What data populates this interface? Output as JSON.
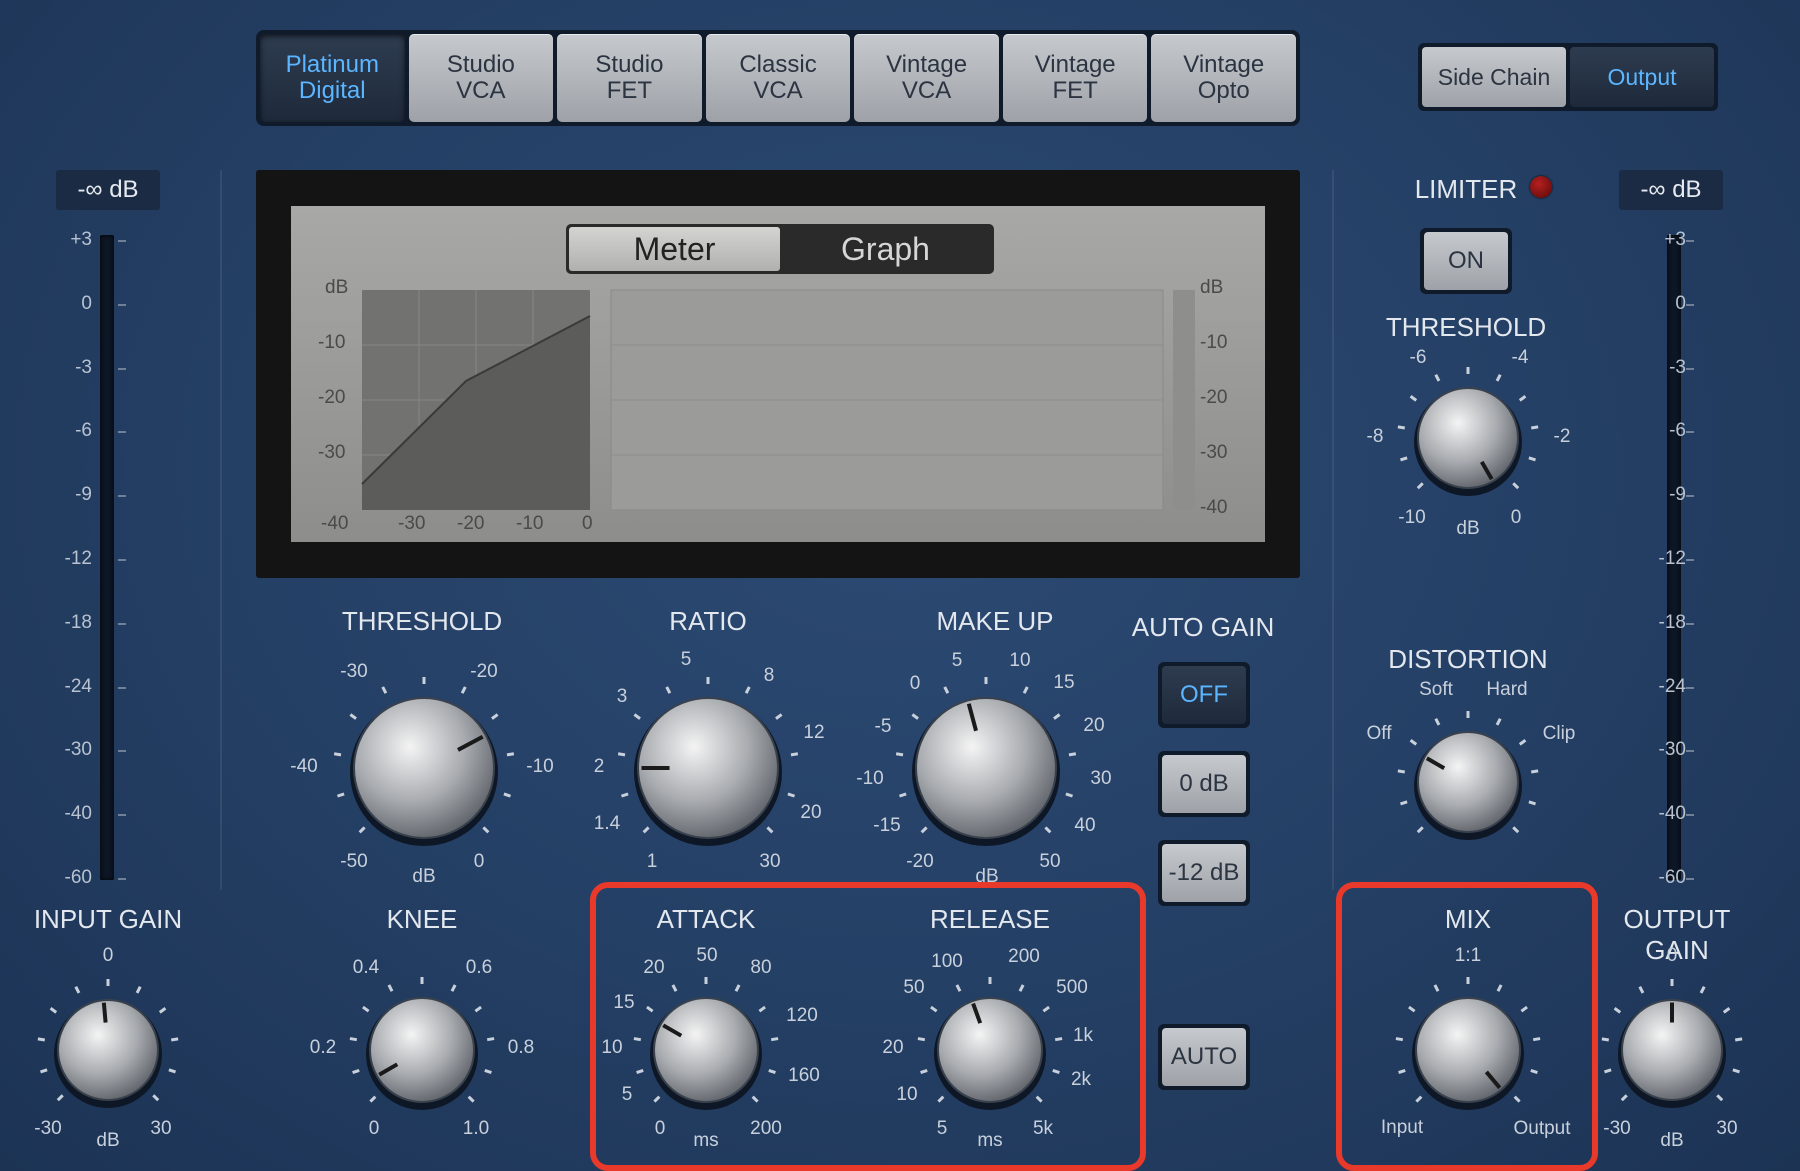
{
  "models": [
    {
      "label": "Platinum\nDigital",
      "active": true
    },
    {
      "label": "Studio\nVCA",
      "active": false
    },
    {
      "label": "Studio\nFET",
      "active": false
    },
    {
      "label": "Classic\nVCA",
      "active": false
    },
    {
      "label": "Vintage\nVCA",
      "active": false
    },
    {
      "label": "Vintage\nFET",
      "active": false
    },
    {
      "label": "Vintage\nOpto",
      "active": false
    }
  ],
  "routing": {
    "side_chain": "Side Chain",
    "output": "Output",
    "selected": "Output"
  },
  "input_meter": {
    "readout": "-∞ dB",
    "scale": [
      "+3",
      "0",
      "-3",
      "-6",
      "-9",
      "-12",
      "-18",
      "-24",
      "-30",
      "-40",
      "-60"
    ]
  },
  "output_meter": {
    "readout": "-∞ dB",
    "scale": [
      "+3",
      "0",
      "-3",
      "-6",
      "-9",
      "-12",
      "-18",
      "-24",
      "-30",
      "-40",
      "-60"
    ]
  },
  "display": {
    "tabs": {
      "meter": "Meter",
      "graph": "Graph",
      "selected": "Meter"
    },
    "unit": "dB",
    "y_labels": [
      "-10",
      "-20",
      "-30",
      "-40"
    ],
    "x_labels": [
      "-40",
      "-30",
      "-20",
      "-10",
      "0"
    ]
  },
  "knobs": {
    "threshold": {
      "label": "THRESHOLD",
      "unit": "dB",
      "scale": [
        "-40",
        "-50",
        "-30",
        "-20",
        "-10",
        "0"
      ]
    },
    "ratio": {
      "label": "RATIO",
      "unit": ":1",
      "scale": [
        "1",
        "1.4",
        "2",
        "3",
        "5",
        "8",
        "12",
        "20",
        "30"
      ]
    },
    "makeup": {
      "label": "MAKE UP",
      "unit": "dB",
      "scale": [
        "-20",
        "-15",
        "-10",
        "-5",
        "0",
        "5",
        "10",
        "15",
        "20",
        "30",
        "40",
        "50"
      ]
    },
    "knee": {
      "label": "KNEE",
      "scale": [
        "0",
        "0.2",
        "0.4",
        "0.6",
        "0.8",
        "1.0"
      ]
    },
    "attack": {
      "label": "ATTACK",
      "unit": "ms",
      "scale": [
        "0",
        "5",
        "10",
        "15",
        "20",
        "50",
        "80",
        "120",
        "160",
        "200"
      ]
    },
    "release": {
      "label": "RELEASE",
      "unit": "ms",
      "scale": [
        "5",
        "10",
        "20",
        "50",
        "100",
        "200",
        "500",
        "1k",
        "2k",
        "5k"
      ]
    },
    "input_gain": {
      "label": "INPUT GAIN",
      "unit": "dB",
      "scale": [
        "-30",
        "0",
        "30"
      ]
    },
    "output_gain": {
      "label": "OUTPUT GAIN",
      "unit": "dB",
      "scale": [
        "-30",
        "0",
        "30"
      ]
    },
    "limiter_threshold": {
      "label": "THRESHOLD",
      "unit": "dB",
      "scale": [
        "-10",
        "-8",
        "-6",
        "-4",
        "-2",
        "0"
      ]
    },
    "distortion": {
      "label": "DISTORTION",
      "scale": [
        "Off",
        "Soft",
        "Hard",
        "Clip"
      ]
    },
    "mix": {
      "label": "MIX",
      "scale": [
        "Input",
        "1:1",
        "Output"
      ]
    }
  },
  "auto_gain": {
    "label": "AUTO GAIN",
    "off": "OFF",
    "zero": "0 dB",
    "minus12": "-12 dB"
  },
  "auto_button": "AUTO",
  "limiter": {
    "label": "LIMITER",
    "on": "ON"
  },
  "colors": {
    "accent": "#5cb5ff",
    "highlight": "#e8392a",
    "panel": "#243f64"
  }
}
